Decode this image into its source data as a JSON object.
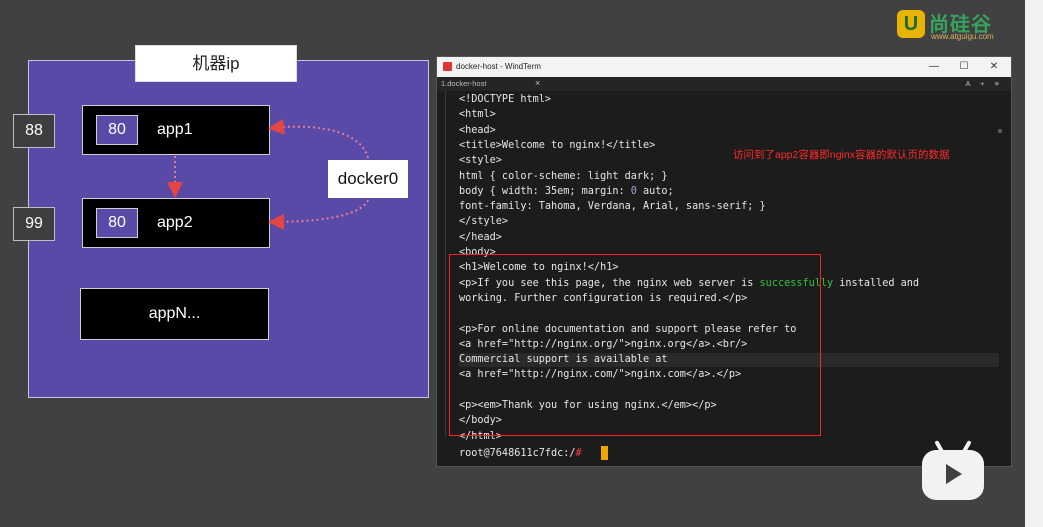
{
  "logo": {
    "mark": "U",
    "name": "尚硅谷",
    "url": "www.atguigu.com"
  },
  "diagram": {
    "ip_label": "机器ip",
    "apps": [
      {
        "port": "80",
        "name": "app1"
      },
      {
        "port": "80",
        "name": "app2"
      },
      {
        "name": "appN..."
      }
    ],
    "external_ports": [
      "88",
      "99"
    ],
    "bridge": "docker0"
  },
  "terminal": {
    "title": "docker-host - WindTerm",
    "tab": "1.docker-host",
    "tab_close": "×",
    "tab_tools": "A + ≡",
    "window_buttons": {
      "minimize": "—",
      "maximize": "☐",
      "close": "✕"
    },
    "lines": [
      "<!DOCTYPE html>",
      "<html>",
      "<head>",
      "<title>Welcome to nginx!</title>",
      "<style>",
      "html { color-scheme: light dark; }",
      "body { width: 35em; margin: 0 auto;",
      "font-family: Tahoma, Verdana, Arial, sans-serif; }",
      "</style>",
      "</head>",
      "<body>",
      "<h1>Welcome to nginx!</h1>",
      "<p>If you see this page, the nginx web server is successfully installed and",
      "working. Further configuration is required.</p>",
      "",
      "<p>For online documentation and support please refer to",
      "<a href=\"http://nginx.org/\">nginx.org</a>.<br/>",
      "Commercial support is available at",
      "<a href=\"http://nginx.com/\">nginx.com</a>.</p>",
      "",
      "<p><em>Thank you for using nginx.</em></p>",
      "</body>",
      "</html>"
    ],
    "prompt_user": "root@7648611c7fdc:/",
    "prompt_symbol": "#",
    "highlight_word": "successfully"
  },
  "annotation": "访问到了app2容器即nginx容器的默认页的数据",
  "colors": {
    "host_box": "#5a4aa7",
    "annotation_red": "#ff2a2a",
    "terminal_bg": "#1c1c1c",
    "success_green": "#36c23f",
    "cursor": "#f0a500"
  }
}
